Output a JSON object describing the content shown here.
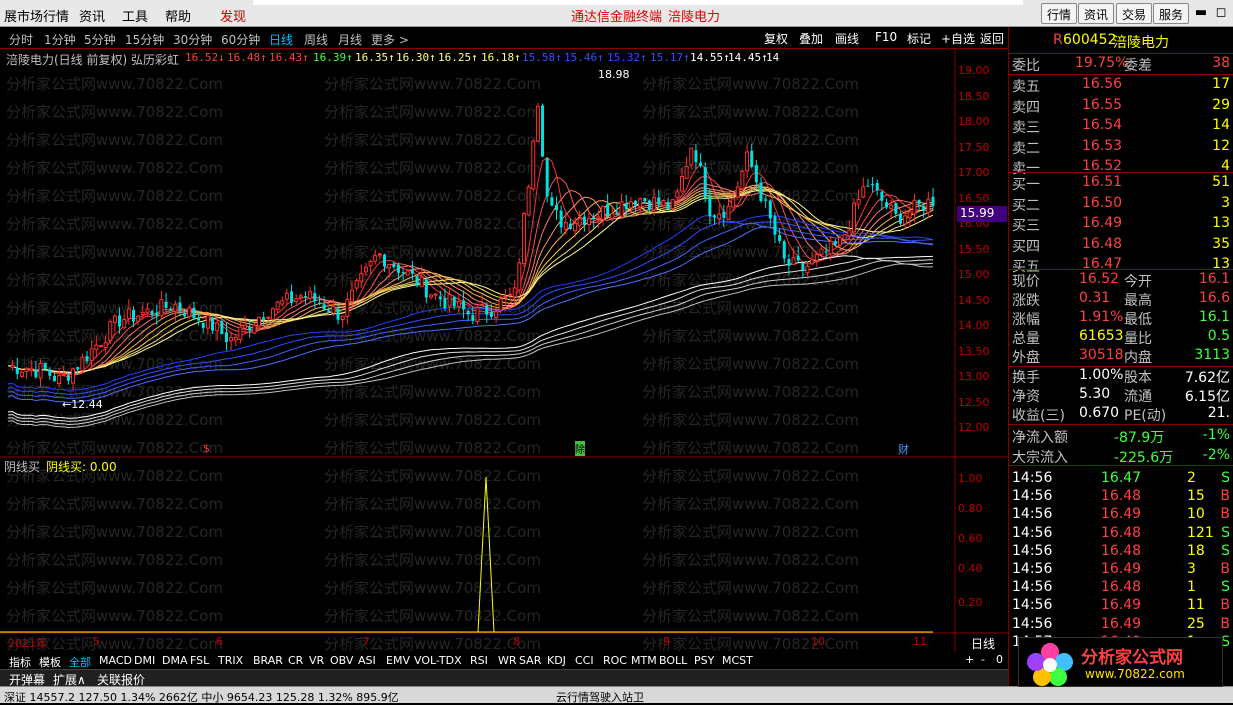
{
  "menu": {
    "items": [
      "展市场行情",
      "资讯",
      "工具",
      "帮助"
    ],
    "discover": "发现",
    "center": "通达信金融终端",
    "center_stock": "涪陵电力",
    "right_buttons": [
      "行情",
      "资讯",
      "交易",
      "服务"
    ]
  },
  "periods": [
    "分时",
    "1分钟",
    "5分钟",
    "15分钟",
    "30分钟",
    "60分钟",
    "日线",
    "周线",
    "月线",
    "更多 >"
  ],
  "active_period": "日线",
  "toolbar_buttons": [
    "复权",
    "叠加",
    "画线",
    "F10",
    "标记",
    "+自选",
    "返回"
  ],
  "chart": {
    "title": "涪陵电力(日线 前复权) 弘历彩虹",
    "ma_values": [
      {
        "text": "16.52↓",
        "color": "#ff4040"
      },
      {
        "text": "16.48↑",
        "color": "#ff4040"
      },
      {
        "text": "16.43↑",
        "color": "#ff4040"
      },
      {
        "text": "16.39↑",
        "color": "#40ff40"
      },
      {
        "text": "16.35↑",
        "color": "#ffff80"
      },
      {
        "text": "16.30↑",
        "color": "#ffff80"
      },
      {
        "text": "16.25↑",
        "color": "#ffff80"
      },
      {
        "text": "16.18↑",
        "color": "#ffff80"
      },
      {
        "text": "15.58↑",
        "color": "#3050ff"
      },
      {
        "text": "15.46↑",
        "color": "#3050ff"
      },
      {
        "text": "15.32↑",
        "color": "#3050ff"
      },
      {
        "text": "15.17↑",
        "color": "#3050ff"
      },
      {
        "text": "14.55↑",
        "color": "#ffffff"
      },
      {
        "text": "14.45↑",
        "color": "#ffffff"
      },
      {
        "text": "14",
        "color": "#ffffff"
      }
    ],
    "price_axis": [
      "19.00",
      "18.50",
      "18.00",
      "17.50",
      "17.00",
      "16.50",
      "16.00",
      "15.50",
      "15.00",
      "14.50",
      "14.00",
      "13.50",
      "13.00",
      "12.50",
      "12.00"
    ],
    "current_price": "15.99",
    "high_label": "18.98",
    "low_label": "←12.44",
    "markers": [
      {
        "text": "$",
        "color": "#ff3030"
      },
      {
        "text": "除",
        "color": "#ffffff"
      },
      {
        "text": "财",
        "color": "#40a0ff"
      }
    ],
    "watermark": "分析家公式网www.70822.Com"
  },
  "indicator": {
    "name": "阴线买",
    "label": "阴线买: 0.00",
    "axis": [
      "1.00",
      "0.80",
      "0.60",
      "0.40",
      "0.20"
    ]
  },
  "x_axis": [
    "2021年",
    "5",
    "6",
    "7",
    "8",
    "9",
    "10",
    "11"
  ],
  "x_axis_right": "日线",
  "x_axis_btns": [
    "+",
    "-",
    "0"
  ],
  "indicator_tabs": [
    "指标",
    "模板",
    "全部",
    "MACD",
    "DMI",
    "DMA",
    "FSL",
    "TRIX",
    "BRAR",
    "CR",
    "VR",
    "OBV",
    "ASI",
    "EMV",
    "VOL-TDX",
    "RSI",
    "WR",
    "SAR",
    "KDJ",
    "CCI",
    "ROC",
    "MTM",
    "BOLL",
    "PSY",
    "MCST"
  ],
  "bottom_bar": [
    "开弹幕",
    "扩展∧",
    "关联报价"
  ],
  "status": {
    "left": "深证 14557.2  127.50  1.34%    2662亿  中小 9654.23  125.28  1.32%    895.9亿",
    "center": "云行情驾驶入站卫"
  },
  "quote": {
    "code": "600452",
    "name": "涪陵电力",
    "r_badge": "R",
    "weibi": {
      "label": "委比",
      "value": "19.75%",
      "label2": "委差",
      "value2": "38"
    },
    "sell": [
      {
        "label": "卖五",
        "price": "16.56",
        "vol": "17"
      },
      {
        "label": "卖四",
        "price": "16.55",
        "vol": "29"
      },
      {
        "label": "卖三",
        "price": "16.54",
        "vol": "14"
      },
      {
        "label": "卖二",
        "price": "16.53",
        "vol": "12"
      },
      {
        "label": "卖一",
        "price": "16.52",
        "vol": "4"
      }
    ],
    "buy": [
      {
        "label": "买一",
        "price": "16.51",
        "vol": "51"
      },
      {
        "label": "买二",
        "price": "16.50",
        "vol": "3"
      },
      {
        "label": "买三",
        "price": "16.49",
        "vol": "13"
      },
      {
        "label": "买四",
        "price": "16.48",
        "vol": "35"
      },
      {
        "label": "买五",
        "price": "16.47",
        "vol": "13"
      }
    ],
    "stats": [
      {
        "l1": "现价",
        "v1": "16.52",
        "l2": "今开",
        "v2": "16.1",
        "c1": "#ff4040",
        "c2": "#ff4040"
      },
      {
        "l1": "涨跌",
        "v1": "0.31",
        "l2": "最高",
        "v2": "16.6",
        "c1": "#ff4040",
        "c2": "#ff4040"
      },
      {
        "l1": "涨幅",
        "v1": "1.91%",
        "l2": "最低",
        "v2": "16.1",
        "c1": "#ff4040",
        "c2": "#40ff40"
      },
      {
        "l1": "总量",
        "v1": "61653",
        "l2": "量比",
        "v2": "0.5",
        "c1": "#ffff00",
        "c2": "#40ff40"
      },
      {
        "l1": "外盘",
        "v1": "30518",
        "l2": "内盘",
        "v2": "3113",
        "c1": "#ff4040",
        "c2": "#40ff40"
      }
    ],
    "stats2": [
      {
        "l1": "换手",
        "v1": "1.00%",
        "l2": "股本",
        "v2": "7.62亿"
      },
      {
        "l1": "净资",
        "v1": "5.30",
        "l2": "流通",
        "v2": "6.15亿"
      },
      {
        "l1": "收益(三)",
        "v1": "0.670",
        "l2": "PE(动)",
        "v2": "21."
      }
    ],
    "flow": [
      {
        "label": "净流入额",
        "value": "-87.9万",
        "pct": "-1%"
      },
      {
        "label": "大宗流入",
        "value": "-225.6万",
        "pct": "-2%"
      }
    ],
    "ticks": [
      {
        "t": "14:56",
        "p": "16.47",
        "v": "2",
        "d": "S"
      },
      {
        "t": "14:56",
        "p": "16.48",
        "v": "15",
        "d": "B"
      },
      {
        "t": "14:56",
        "p": "16.49",
        "v": "10",
        "d": "B"
      },
      {
        "t": "14:56",
        "p": "16.48",
        "v": "121",
        "d": "S"
      },
      {
        "t": "14:56",
        "p": "16.48",
        "v": "18",
        "d": "S"
      },
      {
        "t": "14:56",
        "p": "16.49",
        "v": "3",
        "d": "B"
      },
      {
        "t": "14:56",
        "p": "16.48",
        "v": "1",
        "d": "S"
      },
      {
        "t": "14:56",
        "p": "16.49",
        "v": "11",
        "d": "B"
      },
      {
        "t": "14:56",
        "p": "16.49",
        "v": "25",
        "d": "B"
      },
      {
        "t": "14:57",
        "p": "16.49",
        "v": "1",
        "d": "S"
      }
    ]
  },
  "logo": {
    "name": "分析家公式网",
    "url": "www.70822.com"
  }
}
